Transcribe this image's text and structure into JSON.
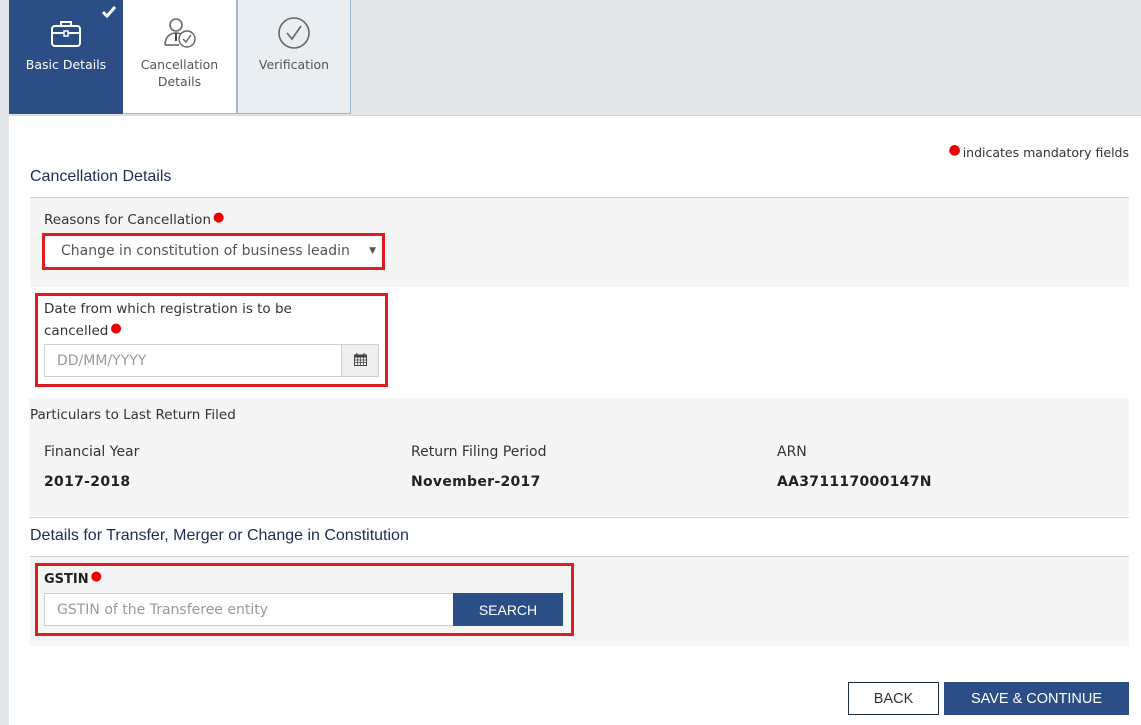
{
  "tabs": [
    {
      "label": "Basic Details",
      "icon": "briefcase-icon",
      "state": "completed"
    },
    {
      "label": "Cancellation Details",
      "icon": "user-check-icon",
      "state": "active"
    },
    {
      "label": "Verification",
      "icon": "check-circle-icon",
      "state": "pending"
    }
  ],
  "mandatory_note": "indicates mandatory fields",
  "cancellation": {
    "title": "Cancellation Details",
    "reason_label": "Reasons for Cancellation",
    "reason_value": "Change in constitution of business leadin",
    "date_label_line1": "Date from which registration is to be",
    "date_label_line2": "cancelled",
    "date_placeholder": "DD/MM/YYYY"
  },
  "last_return": {
    "title": "Particulars to Last Return Filed",
    "columns": [
      {
        "label": "Financial Year",
        "value": "2017-2018"
      },
      {
        "label": "Return Filing Period",
        "value": "November-2017"
      },
      {
        "label": "ARN",
        "value": "AA371117000147N"
      }
    ]
  },
  "transfer": {
    "title": "Details for Transfer, Merger or Change in Constitution",
    "gstin_label": "GSTIN",
    "gstin_placeholder": "GSTIN of the Transferee entity",
    "search_label": "SEARCH"
  },
  "actions": {
    "back_label": "BACK",
    "save_label": "SAVE & CONTINUE"
  },
  "colors": {
    "primary": "#2c4e86",
    "highlight": "#e11b22",
    "required": "#e00000"
  }
}
